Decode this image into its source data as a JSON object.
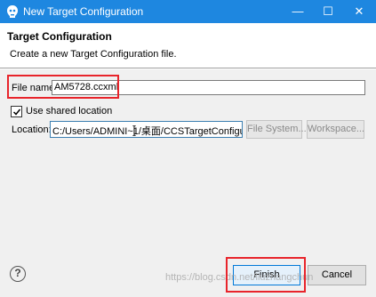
{
  "window": {
    "title": "New Target Configuration",
    "controls": {
      "minimize": "—",
      "maximize": "☐",
      "close": "✕"
    }
  },
  "header": {
    "title": "Target Configuration",
    "description": "Create a new Target Configuration file."
  },
  "form": {
    "file_name_label": "File name:",
    "file_name_value": "AM5728.ccxml",
    "use_shared_label": "Use shared location",
    "use_shared_checked": true,
    "location_label": "Location:",
    "location_value": "C:/Users/ADMINI~1/桌面/CCSTargetConfigurations",
    "file_system_button": "File System...",
    "workspace_button": "Workspace..."
  },
  "footer": {
    "help_label": "?",
    "finish_button": "Finish",
    "cancel_button": "Cancel"
  },
  "watermark": "https://blog.csdn.net/liuzhangchun",
  "colors": {
    "titlebar": "#1e87e0",
    "highlight": "#e8242b",
    "dialog_bg": "#f0f0f0"
  }
}
